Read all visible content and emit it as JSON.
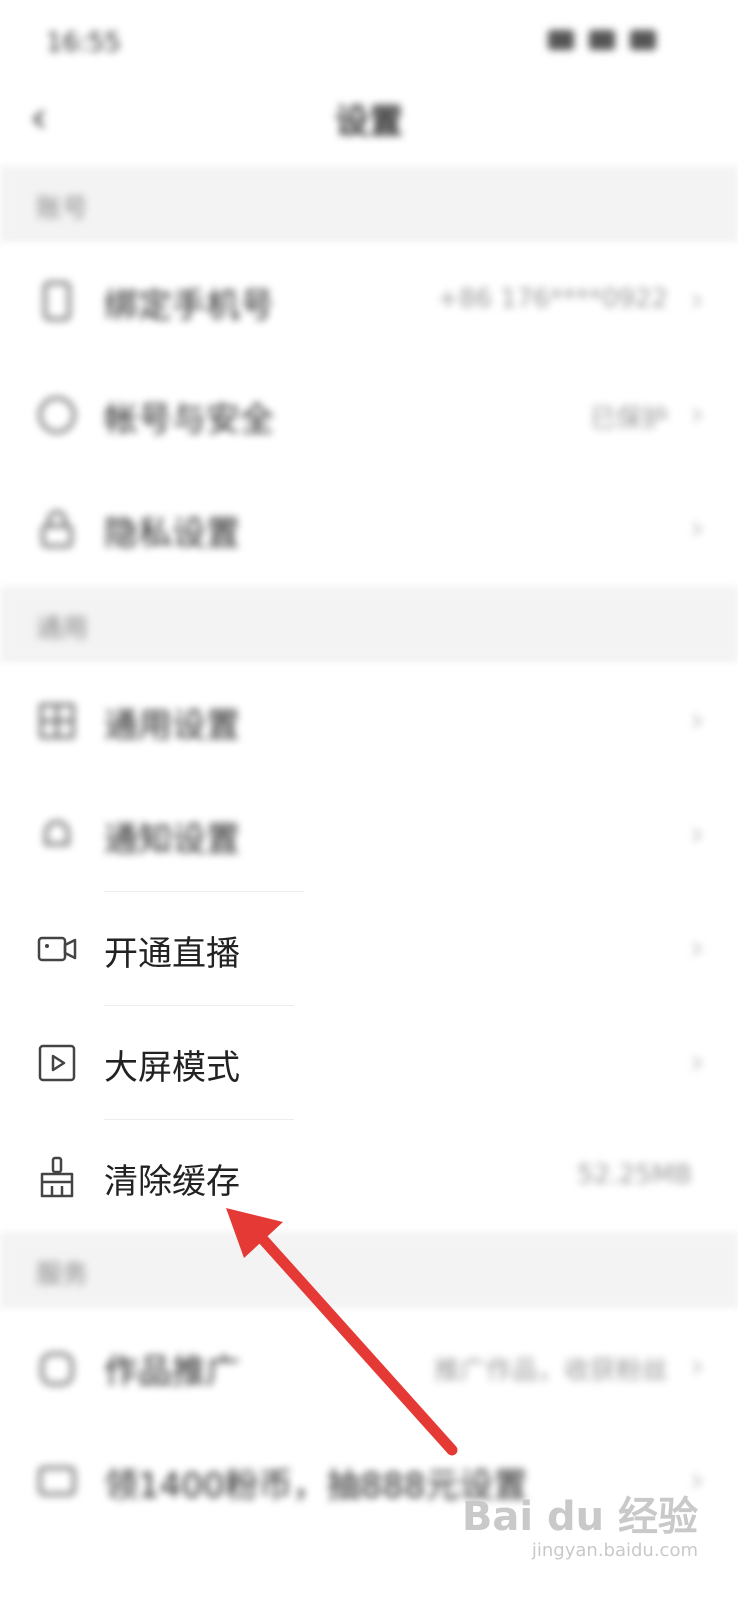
{
  "status_bar": {
    "time": "16:55"
  },
  "header": {
    "back_icon": "back-arrow-icon",
    "title": "设置"
  },
  "sections": [
    {
      "title": "账号",
      "items": [
        {
          "label": "绑定手机号",
          "value": "+86 176****0922",
          "icon": "phone-icon"
        },
        {
          "label": "帐号与安全",
          "value": "已保护",
          "icon": "shield-icon"
        },
        {
          "label": "隐私设置",
          "value": "",
          "icon": "lock-icon"
        }
      ]
    },
    {
      "title": "通用",
      "items": [
        {
          "label": "通用设置",
          "value": "",
          "icon": "grid-icon"
        },
        {
          "label": "通知设置",
          "value": "",
          "icon": "bell-icon"
        },
        {
          "label": "开通直播",
          "value": "",
          "icon": "camera-icon"
        },
        {
          "label": "大屏模式",
          "value": "",
          "icon": "play-icon"
        },
        {
          "label": "清除缓存",
          "value": "52.25MB",
          "icon": "broom-icon"
        }
      ]
    },
    {
      "title": "服务",
      "items": [
        {
          "label": "作品推广",
          "value": "推广作品，收获粉丝",
          "icon": "promo-icon"
        },
        {
          "label": "领1400粉币，抽888元设置",
          "value": "",
          "icon": "coin-icon"
        }
      ]
    }
  ],
  "chevron": "›",
  "annotation_arrow_color": "#e53935",
  "watermark": {
    "text": "Bai du 经验",
    "sub": "jingyan.baidu.com"
  }
}
